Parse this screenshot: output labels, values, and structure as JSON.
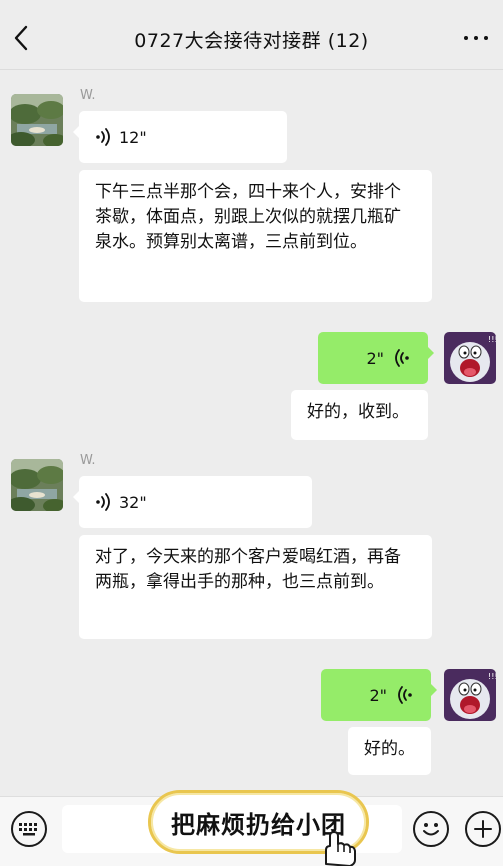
{
  "header": {
    "title": "0727大会接待对接群 (12)",
    "back_icon": "chevron-left-icon",
    "more_icon": "more-horizontal-icon"
  },
  "messages": [
    {
      "direction": "in",
      "sender": "W.",
      "type": "voice",
      "duration": "12\""
    },
    {
      "direction": "in",
      "type": "text",
      "text": "下午三点半那个会，四十来个人，安排个茶歇，体面点，别跟上次似的就摆几瓶矿泉水。预算别太离谱，三点前到位。"
    },
    {
      "direction": "out",
      "type": "voice",
      "duration": "2\""
    },
    {
      "direction": "out",
      "type": "text",
      "text": "好的，收到。"
    },
    {
      "direction": "in",
      "sender": "W.",
      "type": "voice",
      "duration": "32\""
    },
    {
      "direction": "in",
      "type": "text",
      "text": "对了，今天来的那个客户爱喝红酒，再备两瓶，拿得出手的那种，也三点前到。"
    },
    {
      "direction": "out",
      "type": "voice",
      "duration": "2\""
    },
    {
      "direction": "out",
      "type": "text",
      "text": "好的。"
    }
  ],
  "bottom_bar": {
    "keyboard_icon": "keyboard-icon",
    "emoji_icon": "emoji-icon",
    "plus_icon": "plus-icon",
    "promo_label": "把麻烦扔给小团"
  },
  "colors": {
    "background": "#ededed",
    "incoming_bubble": "#ffffff",
    "outgoing_bubble": "#95ec69",
    "promo_border": "#e9c64f"
  }
}
